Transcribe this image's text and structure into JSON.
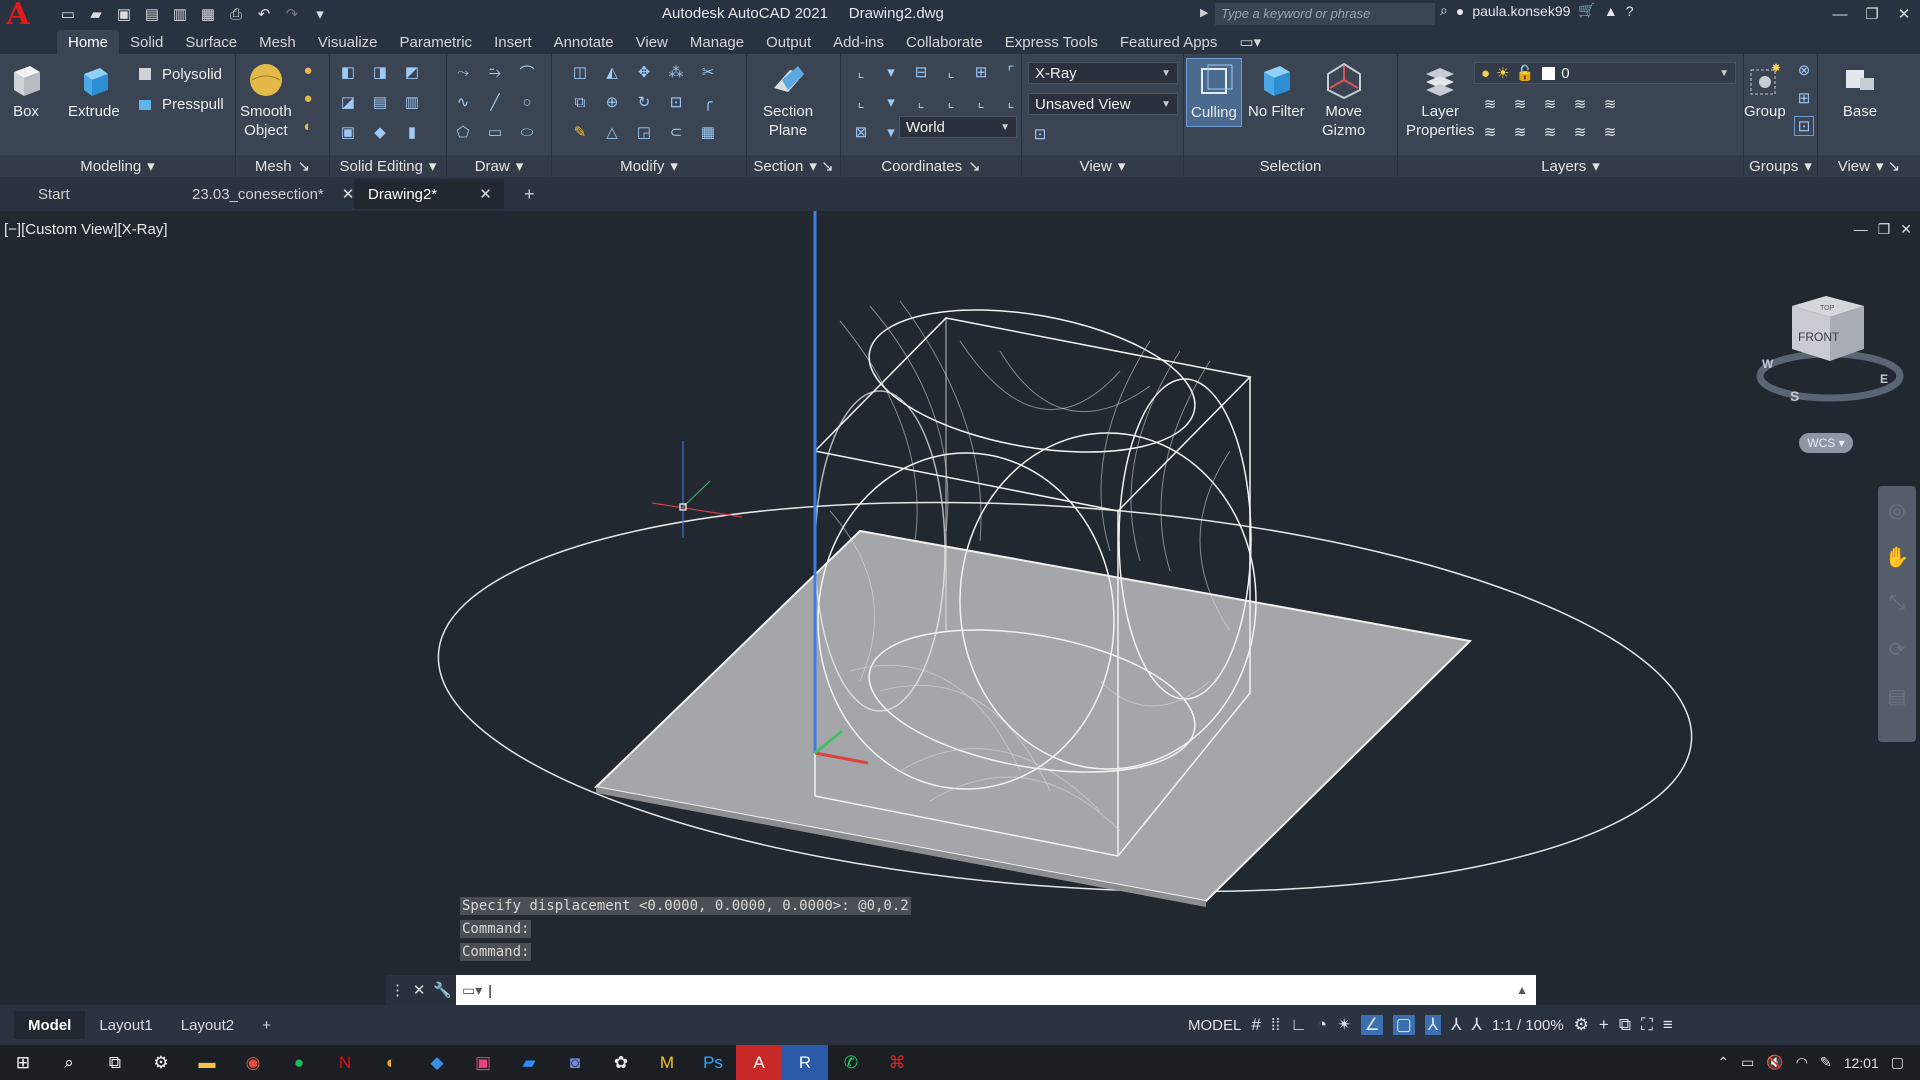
{
  "titlebar": {
    "app_title": "Autodesk AutoCAD 2021",
    "doc_title": "Drawing2.dwg",
    "search_placeholder": "Type a keyword or phrase",
    "user": "paula.konsek99"
  },
  "ribbon_tabs": [
    "Home",
    "Solid",
    "Surface",
    "Mesh",
    "Visualize",
    "Parametric",
    "Insert",
    "Annotate",
    "View",
    "Manage",
    "Output",
    "Add-ins",
    "Collaborate",
    "Express Tools",
    "Featured Apps"
  ],
  "ribbon": {
    "modeling": {
      "title": "Modeling",
      "box": "Box",
      "extrude": "Extrude",
      "polysolid": "Polysolid",
      "presspull": "Presspull"
    },
    "mesh": {
      "title": "Mesh",
      "smooth_object": "Smooth\nObject"
    },
    "solid_editing": {
      "title": "Solid Editing"
    },
    "draw": {
      "title": "Draw"
    },
    "modify": {
      "title": "Modify"
    },
    "section": {
      "title": "Section",
      "section_plane": "Section\nPlane"
    },
    "coordinates": {
      "title": "Coordinates",
      "ucs": "World"
    },
    "view": {
      "title": "View",
      "visual_style": "X-Ray",
      "named_view": "Unsaved View"
    },
    "selection": {
      "title": "Selection",
      "culling": "Culling",
      "no_filter": "No Filter",
      "move_gizmo": "Move\nGizmo"
    },
    "layers": {
      "title": "Layers",
      "layer_properties": "Layer\nProperties",
      "current_layer": "0"
    },
    "groups": {
      "title": "Groups",
      "group": "Group"
    },
    "view2": {
      "title": "View",
      "base": "Base"
    }
  },
  "doc_tabs": [
    {
      "label": "Start"
    },
    {
      "label": "23.03_conesection*"
    },
    {
      "label": "Drawing2*"
    }
  ],
  "viewport": {
    "label": "[−][Custom View][X-Ray]",
    "viewcube_face": "FRONT",
    "viewcube_top": "TOP",
    "wcs": "WCS"
  },
  "command_history": [
    "Specify displacement <0.0000, 0.0000, 0.0000>: @0,0.2",
    "Command:",
    "Command:"
  ],
  "layout_tabs": [
    "Model",
    "Layout1",
    "Layout2"
  ],
  "status": {
    "space": "MODEL",
    "scale": "1:1 / 100%"
  },
  "taskbar": {
    "time": "12:01"
  },
  "colors": {
    "accent": "#3b6fb0",
    "background": "#212830",
    "ribbon": "#3b4453"
  }
}
